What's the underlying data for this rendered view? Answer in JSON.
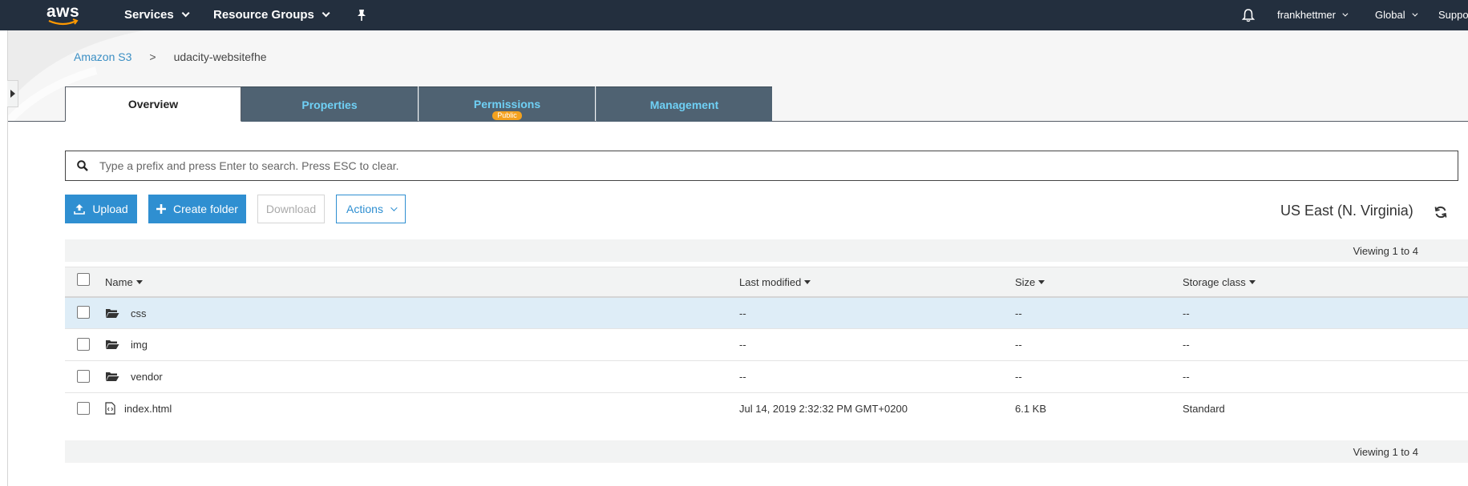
{
  "topnav": {
    "logo_text": "aws",
    "services": "Services",
    "resource_groups": "Resource Groups",
    "user": "frankhettmer",
    "region": "Global",
    "support": "Suppo"
  },
  "breadcrumb": {
    "root": "Amazon S3",
    "separator": ">",
    "current": "udacity-websitefhe"
  },
  "tabs": [
    {
      "label": "Overview",
      "active": true
    },
    {
      "label": "Properties",
      "active": false
    },
    {
      "label": "Permissions",
      "active": false,
      "badge": "Public"
    },
    {
      "label": "Management",
      "active": false
    }
  ],
  "search": {
    "placeholder": "Type a prefix and press Enter to search. Press ESC to clear.",
    "value": ""
  },
  "actions": {
    "upload": "Upload",
    "create_folder": "Create folder",
    "download": "Download",
    "actions": "Actions"
  },
  "region_label": "US East (N. Virginia)",
  "viewing_top": "Viewing 1 to 4",
  "viewing_bottom": "Viewing 1 to 4",
  "table": {
    "columns": {
      "name": "Name",
      "last_modified": "Last modified",
      "size": "Size",
      "storage_class": "Storage class"
    },
    "rows": [
      {
        "name": "css",
        "type": "folder",
        "last_modified": "--",
        "size": "--",
        "storage_class": "--",
        "selected": true
      },
      {
        "name": "img",
        "type": "folder",
        "last_modified": "--",
        "size": "--",
        "storage_class": "--",
        "selected": false
      },
      {
        "name": "vendor",
        "type": "folder",
        "last_modified": "--",
        "size": "--",
        "storage_class": "--",
        "selected": false
      },
      {
        "name": "index.html",
        "type": "file",
        "last_modified": "Jul 14, 2019 2:32:32 PM GMT+0200",
        "size": "6.1 KB",
        "storage_class": "Standard",
        "selected": false
      }
    ]
  },
  "colors": {
    "nav_bg": "#232f3e",
    "tab_dark_bg": "#4f6272",
    "tab_dark_text": "#6fd0f5",
    "primary": "#2f8fd1",
    "badge": "#f4a21f",
    "selected_row": "#deedf7",
    "link": "#3b8fc4"
  },
  "icons": {
    "logo": "aws-smile-logo",
    "pin": "pin-icon",
    "bell": "bell-icon",
    "search": "search-icon",
    "upload": "upload-icon",
    "create_folder": "plus-icon",
    "actions": "chevron-down-icon",
    "refresh": "refresh-icon",
    "folder": "folder-open-icon",
    "file": "html-file-icon"
  }
}
